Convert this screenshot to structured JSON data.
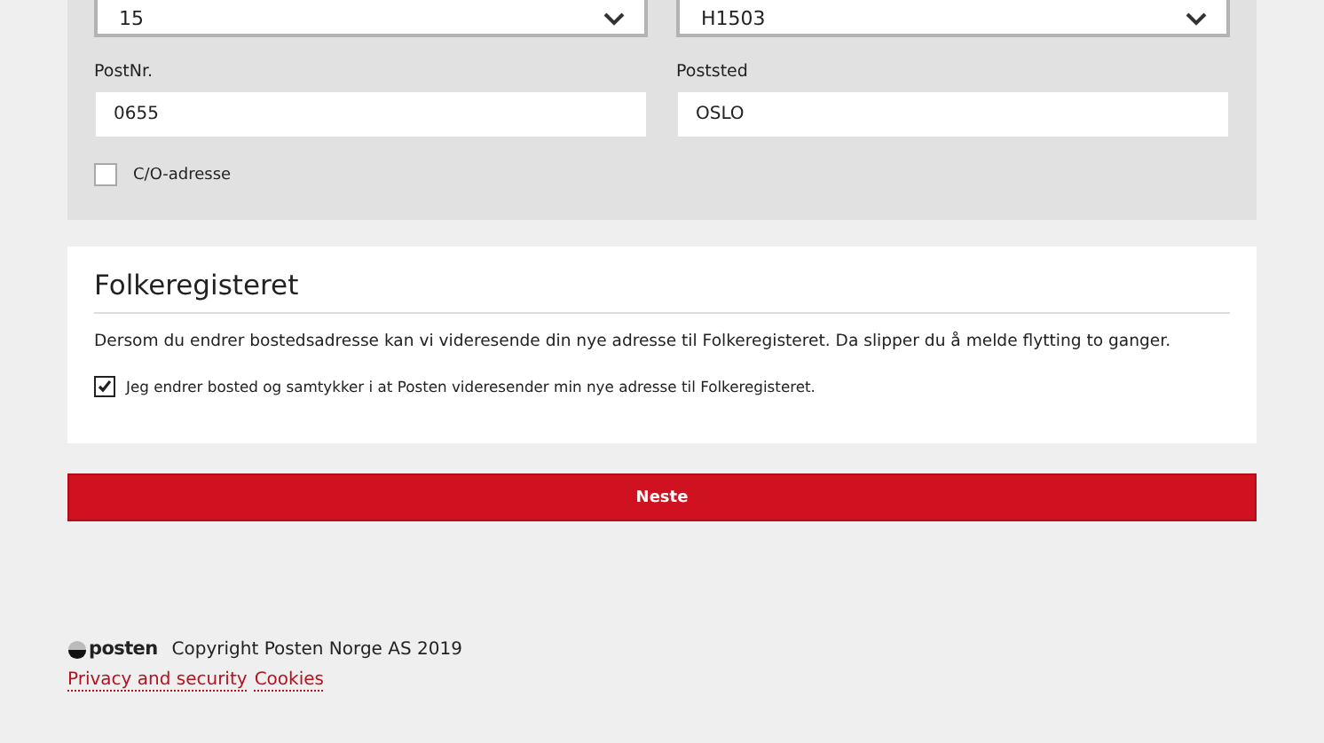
{
  "address_form": {
    "selects": [
      {
        "value": "15"
      },
      {
        "value": "H1503"
      }
    ],
    "fields": [
      {
        "label": "PostNr.",
        "value": "0655"
      },
      {
        "label": "Poststed",
        "value": "OSLO"
      }
    ],
    "co_address": {
      "label": "C/O-adresse",
      "checked": false
    }
  },
  "folkeregisteret": {
    "title": "Folkeregisteret",
    "text": "Dersom du endrer bostedsadresse kan vi videresende din nye adresse til Folkeregisteret. Da slipper du å melde flytting to ganger.",
    "consent": {
      "label": "Jeg endrer bosted og samtykker i at Posten videresender min nye adresse til Folkeregisteret.",
      "checked": true
    }
  },
  "next_button": "Neste",
  "footer": {
    "logo_text": "posten",
    "copyright": "Copyright Posten Norge AS 2019",
    "links": [
      "Privacy and security",
      "Cookies"
    ]
  }
}
